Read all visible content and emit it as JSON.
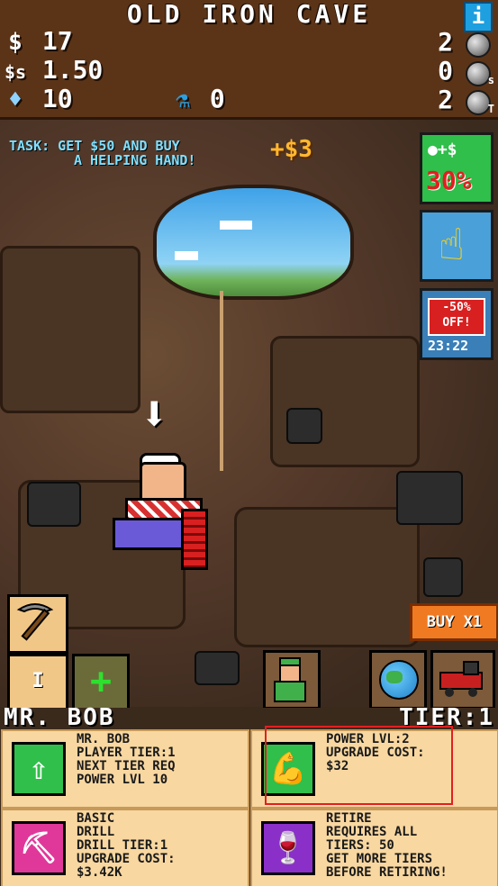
{
  "header": {
    "title": "OLD IRON CAVE",
    "info_label": "i",
    "cash": "17",
    "cash_icon": "$",
    "income": "1.50",
    "income_icon": "$s",
    "gems": "10",
    "gem_icon": "♦",
    "potions": "0",
    "ore_rows": [
      {
        "count": "2",
        "sub": ""
      },
      {
        "count": "0",
        "sub": "s"
      },
      {
        "count": "2",
        "sub": "T"
      }
    ]
  },
  "task": {
    "line1": "TASK: GET $50 AND BUY",
    "line2": "A HELPING HAND!",
    "reward": "+$3"
  },
  "side": {
    "boost_top": "●+$",
    "boost_pct": "30%",
    "sale_badge": "-50% OFF!",
    "sale_timer": "23:22"
  },
  "buy_label": "BUY X1",
  "tier_label": "I",
  "add_label": "+",
  "name_bar": {
    "name": "MR. BOB",
    "tier": "TIER:1"
  },
  "panels": {
    "player": "MR. BOB\nPLAYER TIER:1\nNEXT TIER REQ\nPOWER LVL 10",
    "power": "POWER LVL:2\nUPGRADE COST:\n$32",
    "drill": "BASIC\nDRILL\nDRILL TIER:1\nUPGRADE COST:\n$3.42K",
    "retire": "RETIRE\nREQUIRES ALL\nTIERS: 50\nGET MORE TIERS\nBEFORE RETIRING!"
  },
  "colors": {
    "accent": "#2fbf4a",
    "sale": "#d82020",
    "buy": "#f07a22",
    "highlight": "#e02020"
  }
}
